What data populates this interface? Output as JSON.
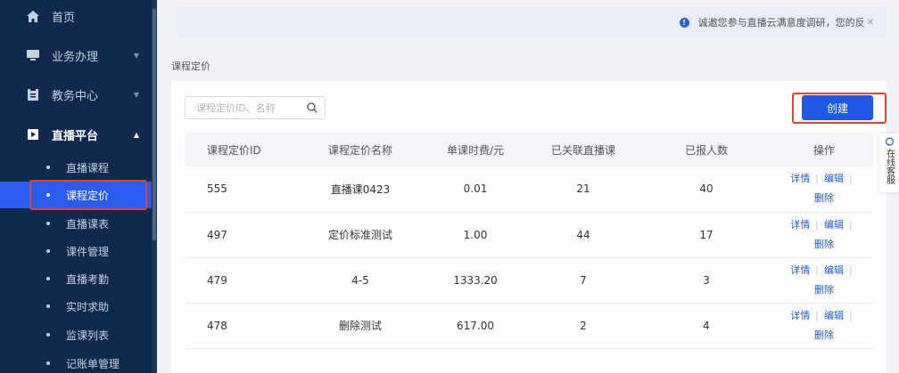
{
  "sidebar": {
    "menus": [
      {
        "label": "首页",
        "icon": "home-icon"
      },
      {
        "label": "业务办理",
        "icon": "monitor-icon"
      },
      {
        "label": "教务中心",
        "icon": "clipboard-icon"
      },
      {
        "label": "直播平台",
        "icon": "play-icon"
      }
    ],
    "sub_items": [
      {
        "label": "直播课程"
      },
      {
        "label": "课程定价"
      },
      {
        "label": "直播课表"
      },
      {
        "label": "课件管理"
      },
      {
        "label": "直播考勤"
      },
      {
        "label": "实时求助"
      },
      {
        "label": "监课列表"
      },
      {
        "label": "记账单管理"
      }
    ]
  },
  "notice": {
    "text": "诚邀您参与直播云满意度调研，您的反"
  },
  "page_title": "课程定价",
  "search": {
    "placeholder": "课程定价ID、名称"
  },
  "create_button": "创建",
  "table": {
    "headers": [
      "课程定价ID",
      "课程定价名称",
      "单课时费/元",
      "已关联直播课",
      "已报人数",
      "操作"
    ],
    "rows": [
      {
        "id": "555",
        "name": "直播课0423",
        "fee": "0.01",
        "linked": "21",
        "enrolled": "40"
      },
      {
        "id": "497",
        "name": "定价标准测试",
        "fee": "1.00",
        "linked": "44",
        "enrolled": "17"
      },
      {
        "id": "479",
        "name": "4-5",
        "fee": "1333.20",
        "linked": "7",
        "enrolled": "3"
      },
      {
        "id": "478",
        "name": "删除测试",
        "fee": "617.00",
        "linked": "2",
        "enrolled": "4"
      }
    ],
    "ops": {
      "detail": "详情",
      "edit": "编辑",
      "delete": "删除"
    }
  },
  "cs_tab": "在线客服",
  "colors": {
    "sidebar_bg": "#0f2a4d",
    "accent": "#1e5ae6",
    "highlight": "#e0452b"
  }
}
